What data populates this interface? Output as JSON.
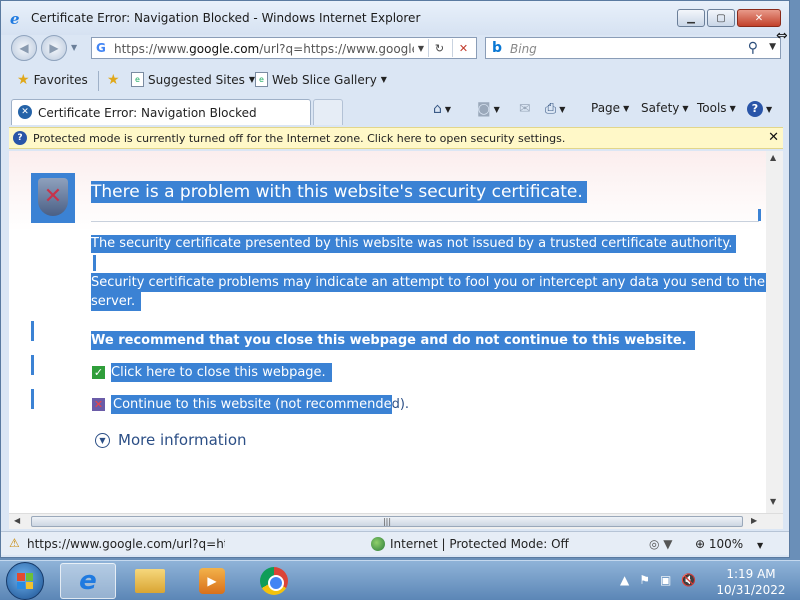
{
  "window": {
    "title": "Certificate Error: Navigation Blocked - Windows Internet Explorer",
    "minimize": "▁",
    "maximize": "▢",
    "close": "✕"
  },
  "address_bar": {
    "scheme": "https://www.",
    "domain": "google.com",
    "rest": "/url?q=https://www.google.co",
    "refresh": "↻",
    "stop": "✕"
  },
  "search": {
    "placeholder": "Bing",
    "engine_glyph": "b"
  },
  "favorites_bar": {
    "favorites_label": "Favorites",
    "suggested_sites": "Suggested Sites",
    "web_slice_gallery": "Web Slice Gallery"
  },
  "tab": {
    "label": "Certificate Error: Navigation Blocked"
  },
  "command_bar": {
    "page": "Page",
    "safety": "Safety",
    "tools": "Tools",
    "help": "?"
  },
  "info_bar": {
    "text": "Protected mode is currently turned off for the Internet zone.  Click here to open security settings.",
    "close": "✕"
  },
  "error_page": {
    "heading": "There is a problem with this website's security certificate.",
    "para1": "The security certificate presented by this website was not issued by a trusted certificate authority.",
    "para2_line1": "Security certificate problems may indicate an attempt to fool you or intercept any data you send to the",
    "para2_line2": "server.",
    "recommend": "We recommend that you close this webpage and do not continue to this website.",
    "close_link": "Click here to close this webpage.",
    "continue_link_selected": "Continue to this website (not recommende",
    "continue_link_rest": "d).",
    "more_info": "More information"
  },
  "status_bar": {
    "url": "https://www.google.com/url?q=http",
    "zone": "Internet | Protected Mode: Off",
    "zoom": "100%"
  },
  "taskbar": {
    "time": "1:19 AM",
    "date": "10/31/2022"
  },
  "colors": {
    "selection": "#3b82d4",
    "infobar": "#fff8c8",
    "link": "#2c4f86"
  }
}
